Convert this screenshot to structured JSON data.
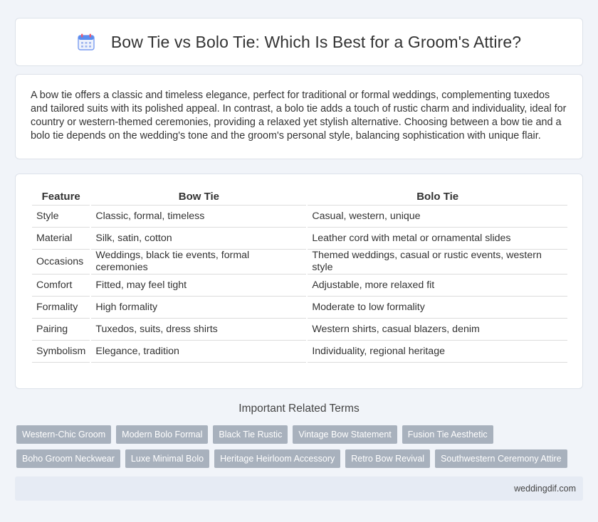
{
  "header": {
    "icon": "calendar-icon",
    "title": "Bow Tie vs Bolo Tie: Which Is Best for a Groom's Attire?"
  },
  "intro": {
    "text": "A bow tie offers a classic and timeless elegance, perfect for traditional or formal weddings, complementing tuxedos and tailored suits with its polished appeal. In contrast, a bolo tie adds a touch of rustic charm and individuality, ideal for country or western-themed ceremonies, providing a relaxed yet stylish alternative. Choosing between a bow tie and a bolo tie depends on the wedding's tone and the groom's personal style, balancing sophistication with unique flair."
  },
  "comparison": {
    "headers": [
      "Feature",
      "Bow Tie",
      "Bolo Tie"
    ],
    "rows": [
      [
        "Style",
        "Classic, formal, timeless",
        "Casual, western, unique"
      ],
      [
        "Material",
        "Silk, satin, cotton",
        "Leather cord with metal or ornamental slides"
      ],
      [
        "Occasions",
        "Weddings, black tie events, formal ceremonies",
        "Themed weddings, casual or rustic events, western style"
      ],
      [
        "Comfort",
        "Fitted, may feel tight",
        "Adjustable, more relaxed fit"
      ],
      [
        "Formality",
        "High formality",
        "Moderate to low formality"
      ],
      [
        "Pairing",
        "Tuxedos, suits, dress shirts",
        "Western shirts, casual blazers, denim"
      ],
      [
        "Symbolism",
        "Elegance, tradition",
        "Individuality, regional heritage"
      ]
    ]
  },
  "related": {
    "title": "Important Related Terms",
    "tags": [
      "Western-Chic Groom",
      "Modern Bolo Formal",
      "Black Tie Rustic",
      "Vintage Bow Statement",
      "Fusion Tie Aesthetic",
      "Boho Groom Neckwear",
      "Luxe Minimal Bolo",
      "Heritage Heirloom Accessory",
      "Retro Bow Revival",
      "Southwestern Ceremony Attire"
    ]
  },
  "footer": {
    "site": "weddingdif.com"
  },
  "colors": {
    "background": "#f1f4f9",
    "tag_bg": "#a8b1bd",
    "footer_bg": "#e6ebf4",
    "icon_blue": "#5b8def",
    "icon_red": "#ee5a6f"
  }
}
